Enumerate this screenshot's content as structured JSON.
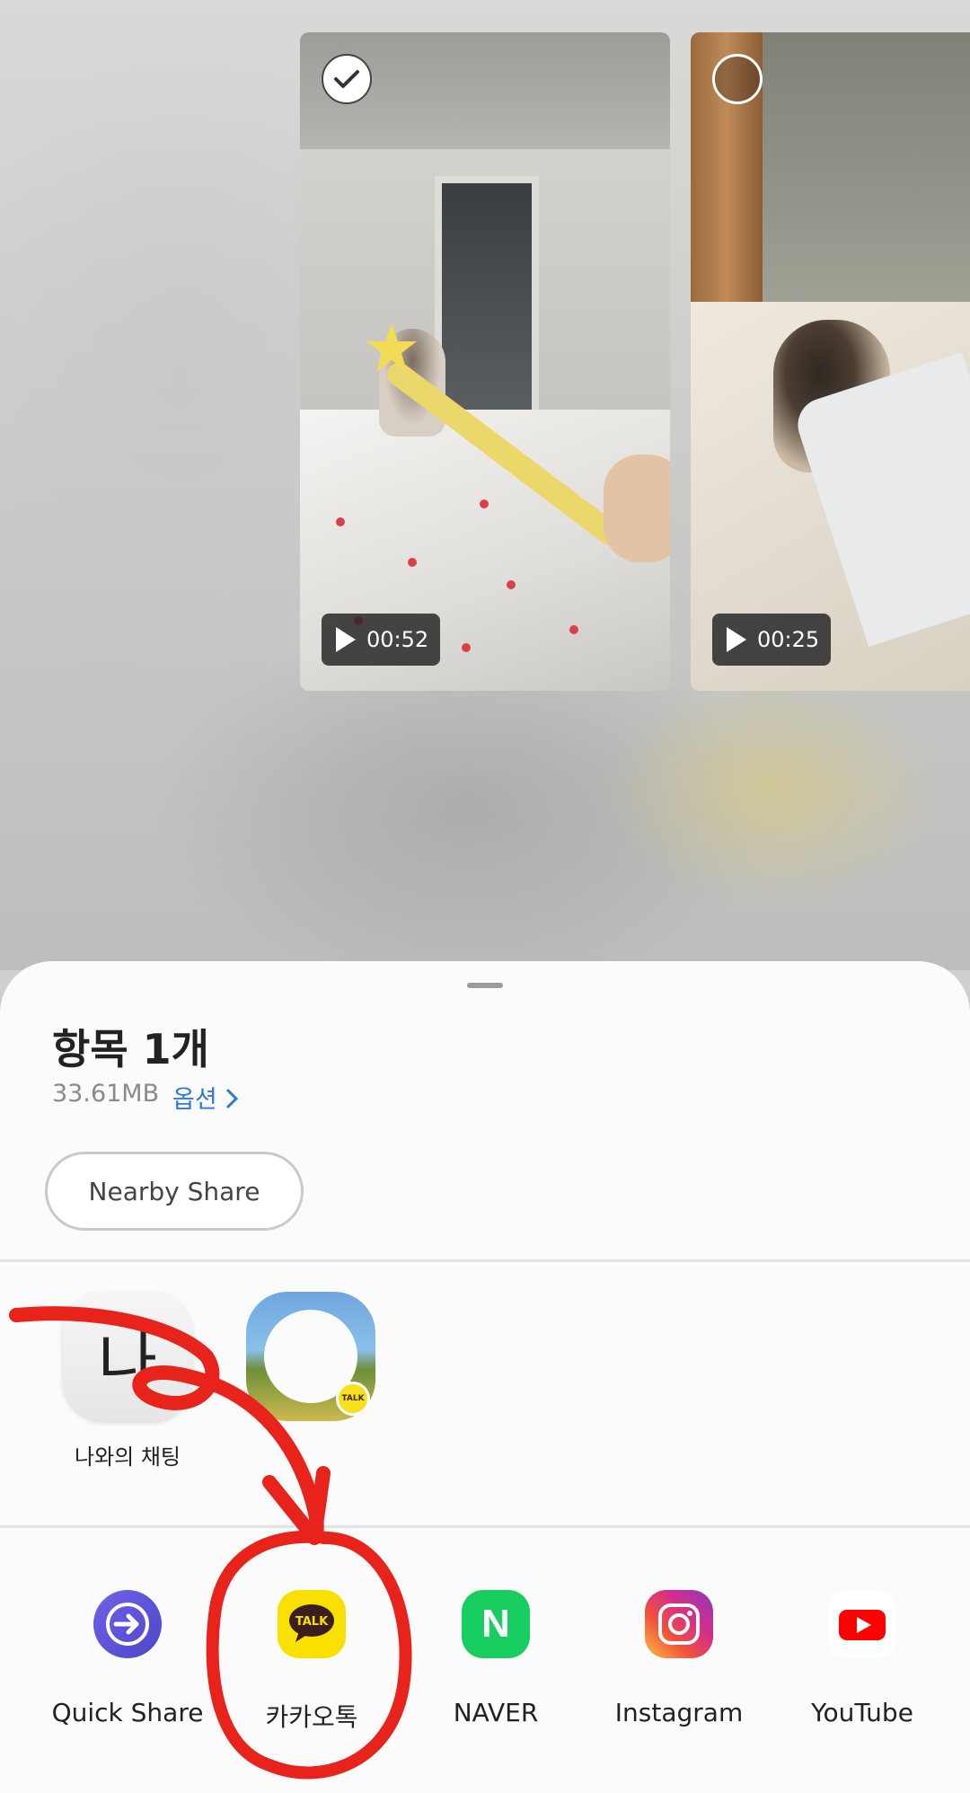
{
  "gallery": {
    "items": [
      {
        "duration": "00:52",
        "selected": true
      },
      {
        "duration": "00:25",
        "selected": false
      }
    ]
  },
  "share_sheet": {
    "title": "항목 1개",
    "size": "33.61MB",
    "options_label": "옵션",
    "nearby_share_label": "Nearby Share",
    "contacts": [
      {
        "label": "나와의 채팅",
        "icon_char": "나",
        "icon": "kakao-me-icon"
      },
      {
        "label": "",
        "icon": "profile-picture-icon"
      }
    ],
    "apps": [
      {
        "label": "Quick Share",
        "icon": "quick-share-icon"
      },
      {
        "label": "카카오톡",
        "icon": "kakaotalk-icon",
        "icon_text": "TALK"
      },
      {
        "label": "NAVER",
        "icon": "naver-icon",
        "icon_text": "N"
      },
      {
        "label": "Instagram",
        "icon": "instagram-icon"
      },
      {
        "label": "YouTube",
        "icon": "youtube-icon"
      }
    ],
    "badge_text": "TALK"
  },
  "colors": {
    "options_link": "#2e7bd6",
    "annotation": "#e8231b",
    "kakao_yellow": "#f9e000",
    "naver_green": "#19ce60"
  }
}
